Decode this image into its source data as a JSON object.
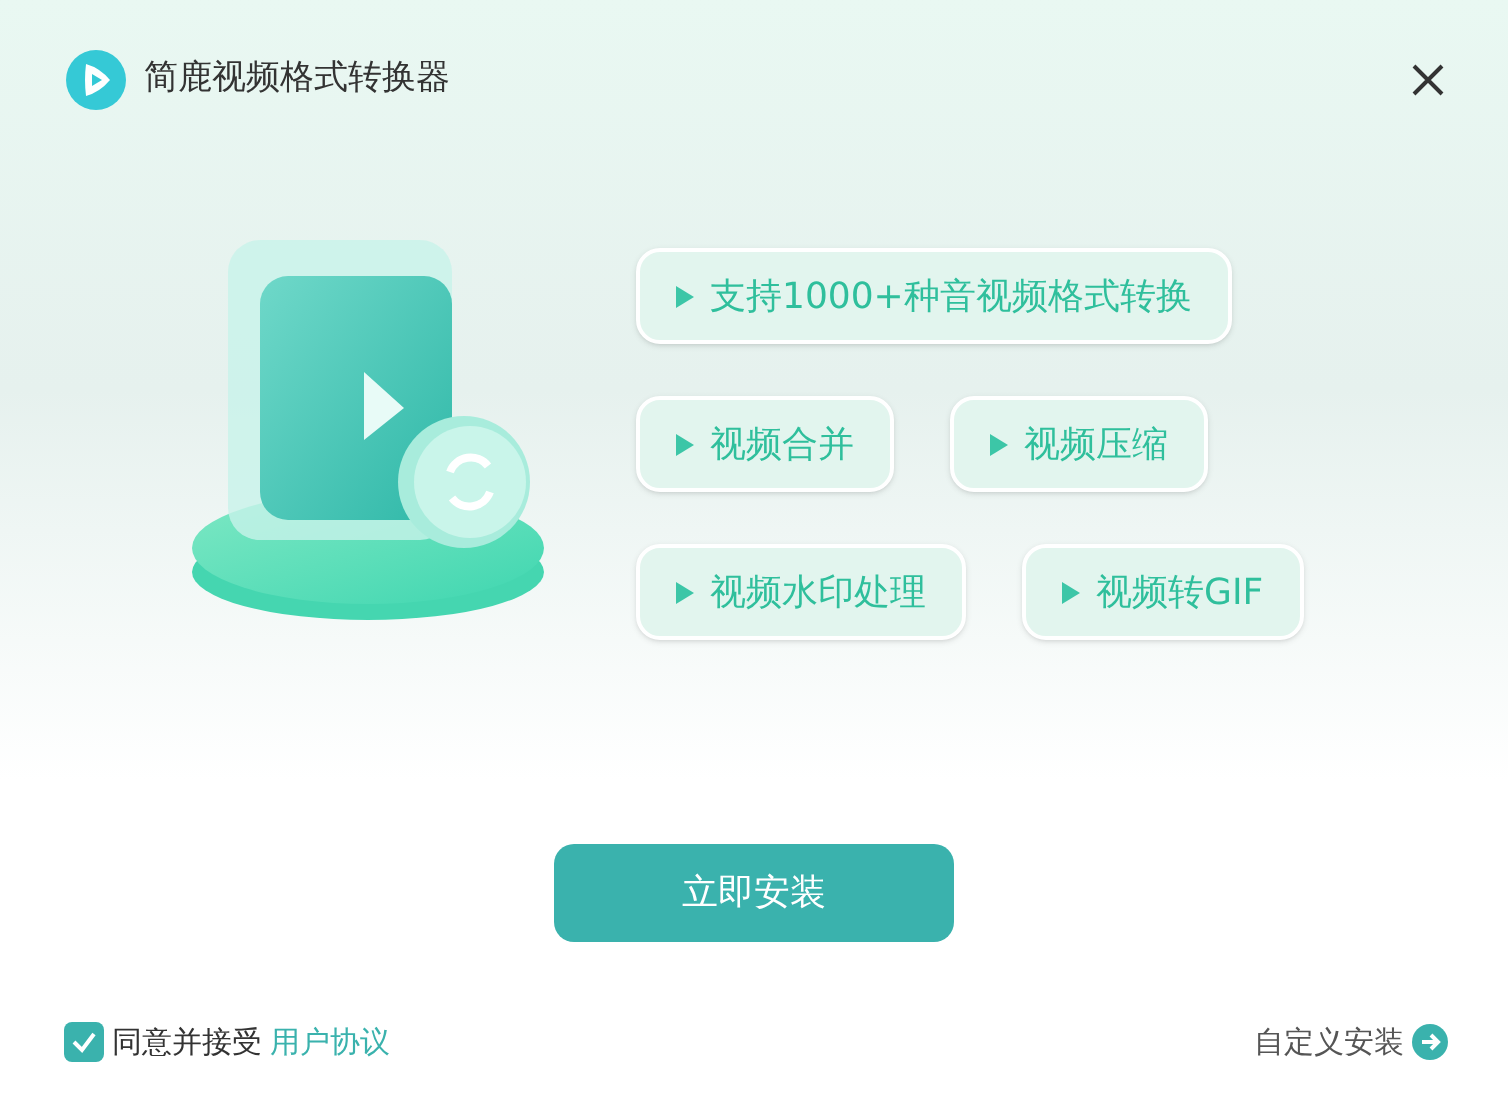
{
  "window": {
    "title": "简鹿视频格式转换器"
  },
  "features": [
    [
      "支持1000+种音视频格式转换"
    ],
    [
      "视频合并",
      "视频压缩"
    ],
    [
      "视频水印处理",
      "视频转GIF"
    ]
  ],
  "install_button": "立即安装",
  "agreement": {
    "checked": true,
    "text": "同意并接受",
    "link": "用户协议"
  },
  "custom_install": "自定义安装"
}
